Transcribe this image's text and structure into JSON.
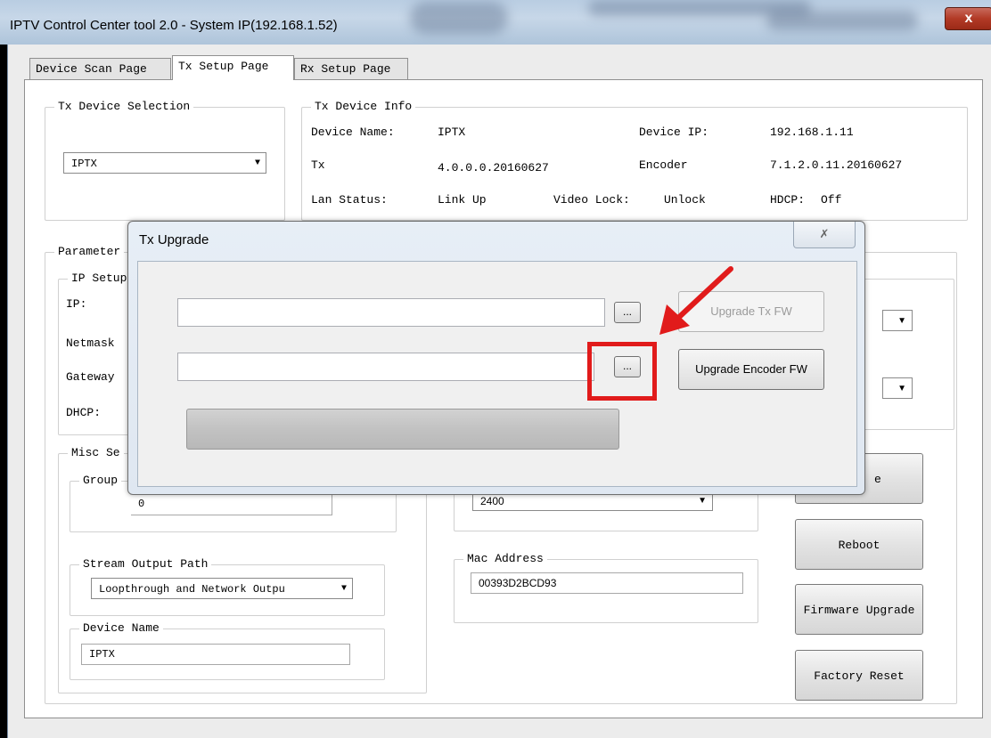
{
  "window": {
    "title": "IPTV Control Center tool 2.0 - System IP(192.168.1.52)",
    "close_glyph": "x"
  },
  "tabs": [
    {
      "label": "Device Scan Page"
    },
    {
      "label": "Tx Setup Page"
    },
    {
      "label": "Rx Setup Page"
    }
  ],
  "tx_device_selection": {
    "legend": "Tx Device Selection",
    "selected": "IPTX"
  },
  "tx_device_info": {
    "legend": "Tx Device Info",
    "device_name_label": "Device Name:",
    "device_name_value": "IPTX",
    "device_ip_label": "Device IP:",
    "device_ip_value": "192.168.1.11",
    "tx_label": "Tx",
    "tx_value": "4.0.0.0.20160627",
    "encoder_label": "Encoder",
    "encoder_value": "7.1.2.0.11.20160627",
    "lan_status_label": "Lan Status:",
    "lan_status_value": "Link Up",
    "video_lock_label": "Video Lock:",
    "video_lock_value": "Unlock",
    "hdcp_label": "HDCP:",
    "hdcp_value": "Off"
  },
  "parameter": {
    "legend": "Parameter",
    "ip_setup_legend": "IP Setup",
    "ip_label": "IP:",
    "netmask_label": "Netmask",
    "gateway_label": "Gateway",
    "dhcp_label": "DHCP:"
  },
  "misc": {
    "legend": "Misc Se",
    "group_legend": "Group",
    "group_value": "0",
    "baud_value": "2400",
    "stream_output_legend": "Stream Output Path",
    "stream_output_value": "Loopthrough and Network Outpu",
    "mac_legend": "Mac Address",
    "mac_value": "00393D2BCD93",
    "device_name_legend": "Device Name",
    "device_name_value": "IPTX"
  },
  "right_buttons": {
    "partial_label": "e",
    "reboot": "Reboot",
    "firmware_upgrade": "Firmware Upgrade",
    "factory_reset": "Factory Reset"
  },
  "dialog": {
    "title": "Tx Upgrade",
    "close_glyph": "✗",
    "tx_fw_path": "",
    "encoder_fw_path": "",
    "browse_label": "...",
    "upgrade_tx_label": "Upgrade Tx FW",
    "upgrade_encoder_label": "Upgrade Encoder FW",
    "progress": 0
  },
  "colors": {
    "annotation": "#e11b1b"
  }
}
